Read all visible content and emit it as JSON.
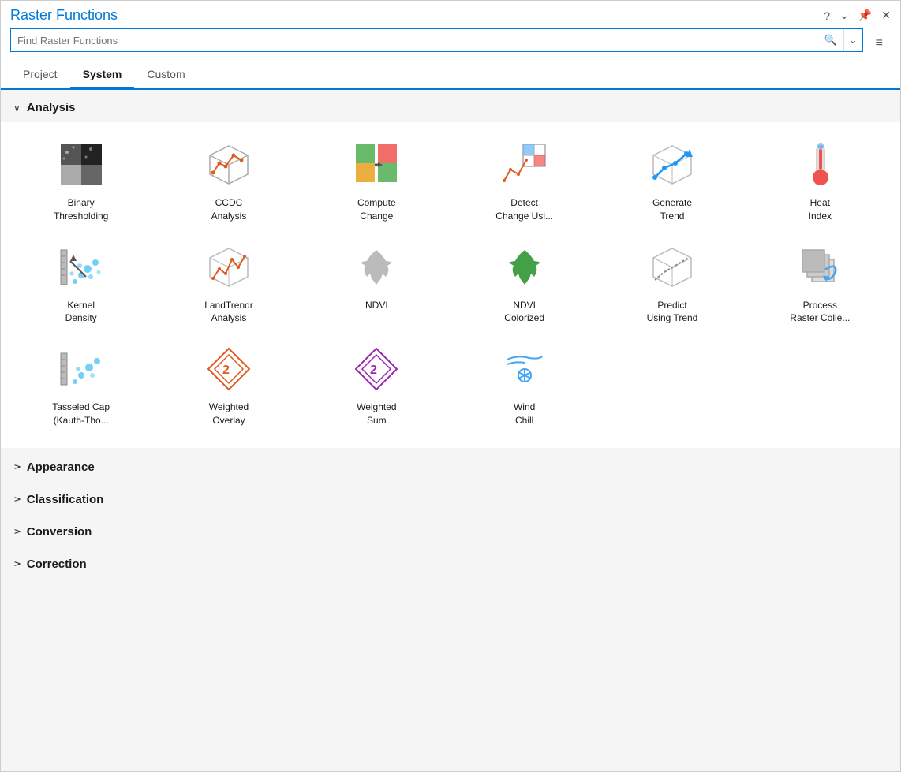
{
  "panel": {
    "title": "Raster Functions",
    "search_placeholder": "Find Raster Functions"
  },
  "tabs": [
    {
      "label": "Project",
      "active": false
    },
    {
      "label": "System",
      "active": true
    },
    {
      "label": "Custom",
      "active": false
    }
  ],
  "sections": [
    {
      "id": "analysis",
      "label": "Analysis",
      "expanded": true,
      "items": [
        {
          "id": "binary-thresholding",
          "label": "Binary\nThresholding"
        },
        {
          "id": "ccdc-analysis",
          "label": "CCDC\nAnalysis"
        },
        {
          "id": "compute-change",
          "label": "Compute\nChange"
        },
        {
          "id": "detect-change",
          "label": "Detect\nChange Usi..."
        },
        {
          "id": "generate-trend",
          "label": "Generate\nTrend"
        },
        {
          "id": "heat-index",
          "label": "Heat\nIndex"
        },
        {
          "id": "kernel-density",
          "label": "Kernel\nDensity"
        },
        {
          "id": "landtrendr-analysis",
          "label": "LandTrendr\nAnalysis"
        },
        {
          "id": "ndvi",
          "label": "NDVI"
        },
        {
          "id": "ndvi-colorized",
          "label": "NDVI\nColorized"
        },
        {
          "id": "predict-using-trend",
          "label": "Predict\nUsing Trend"
        },
        {
          "id": "process-raster-colle",
          "label": "Process\nRaster Colle..."
        },
        {
          "id": "tasseled-cap",
          "label": "Tasseled Cap\n(Kauth-Tho..."
        },
        {
          "id": "weighted-overlay",
          "label": "Weighted\nOverlay"
        },
        {
          "id": "weighted-sum",
          "label": "Weighted\nSum"
        },
        {
          "id": "wind-chill",
          "label": "Wind\nChill"
        }
      ]
    },
    {
      "id": "appearance",
      "label": "Appearance",
      "expanded": false,
      "items": []
    },
    {
      "id": "classification",
      "label": "Classification",
      "expanded": false,
      "items": []
    },
    {
      "id": "conversion",
      "label": "Conversion",
      "expanded": false,
      "items": []
    },
    {
      "id": "correction",
      "label": "Correction",
      "expanded": false,
      "items": []
    }
  ]
}
